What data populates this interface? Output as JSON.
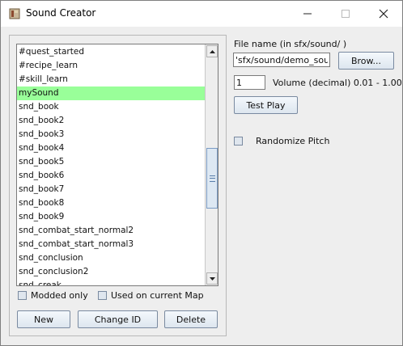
{
  "window": {
    "title": "Sound Creator"
  },
  "sound_list": {
    "selected_index": 3,
    "items": [
      "#quest_started",
      "#recipe_learn",
      "#skill_learn",
      "mySound",
      "snd_book",
      "snd_book2",
      "snd_book3",
      "snd_book4",
      "snd_book5",
      "snd_book6",
      "snd_book7",
      "snd_book8",
      "snd_book9",
      "snd_combat_start_normal2",
      "snd_combat_start_normal3",
      "snd_conclusion",
      "snd_conclusion2",
      "snd_creak"
    ]
  },
  "filters": {
    "modded_only": "Modded only",
    "used_on_map": "Used on current Map"
  },
  "list_buttons": {
    "new": "New",
    "change_id": "Change ID",
    "delete": "Delete"
  },
  "file": {
    "label": "File name (in sfx/sound/ )",
    "value": "'sfx/sound/demo_sound",
    "browse": "Brow..."
  },
  "volume": {
    "value": "1",
    "label": "Volume (decimal) 0.01 - 1.00"
  },
  "test_play": "Test Play",
  "randomize_pitch": "Randomize Pitch",
  "colors": {
    "selection": "#99ff99",
    "titlebar": "#ffffff",
    "background": "#eeeeee"
  }
}
